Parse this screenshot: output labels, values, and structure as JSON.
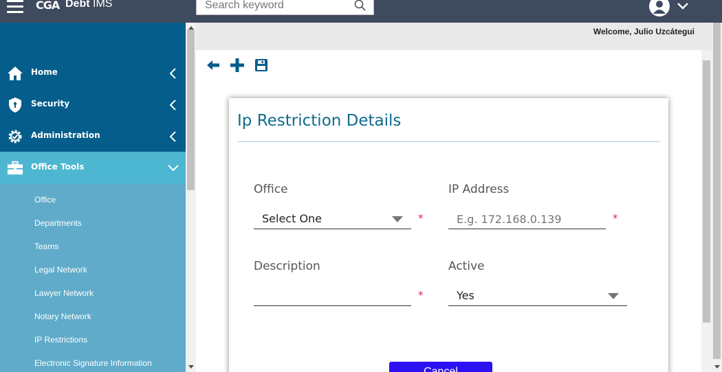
{
  "app": {
    "logo_text": "CGA",
    "name_bold": "Debt",
    "name_light": " IMS"
  },
  "search": {
    "placeholder": "Search keyword"
  },
  "header": {
    "welcome": "Welcome, Julio Uzcátegui"
  },
  "sidebar": {
    "items": [
      {
        "label": "Home",
        "icon": "home-icon"
      },
      {
        "label": "Security",
        "icon": "shield-icon"
      },
      {
        "label": "Administration",
        "icon": "gear-icon"
      },
      {
        "label": "Office Tools",
        "icon": "toolbox-icon",
        "expanded": true
      }
    ],
    "subitems": [
      "Office",
      "Departments",
      "Teams",
      "Legal Network",
      "Lawyer Network",
      "Notary Network",
      "IP Restrictions",
      "Electronic Signature Information"
    ]
  },
  "toolbar": {
    "icons": [
      "back-arrow-icon",
      "add-icon",
      "save-icon"
    ]
  },
  "form": {
    "title": "Ip Restriction Details",
    "office_label": "Office",
    "office_value": "Select One",
    "ip_label": "IP Address",
    "ip_placeholder": "E.g. 172.168.0.139",
    "description_label": "Description",
    "description_value": "",
    "active_label": "Active",
    "active_value": "Yes",
    "required_mark": "*",
    "button_label": "Cancel"
  },
  "colors": {
    "topbar": "#3e4a5e",
    "sidebar_dark": "#045d8a",
    "sidebar_light": "#5fabc9",
    "sidebar_active": "#4db6d1",
    "title": "#0f6b8f",
    "required": "#e0245e",
    "button": "#2c11f5"
  }
}
